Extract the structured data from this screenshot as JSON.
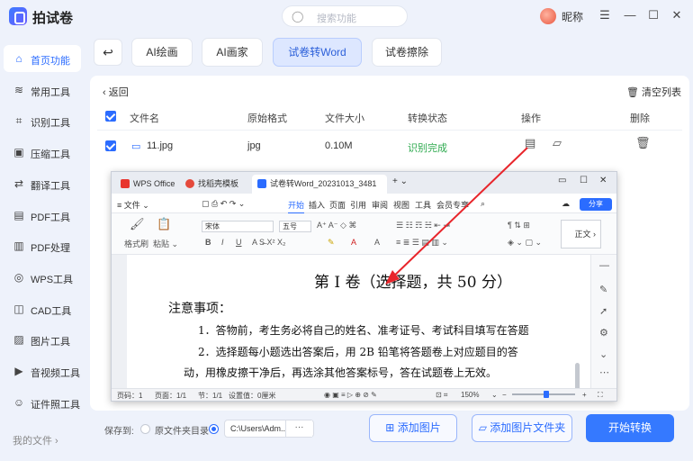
{
  "app": {
    "name": "拍试卷",
    "search_placeholder": "搜索功能",
    "nickname": "昵称"
  },
  "window_controls": [
    "☰",
    "—",
    "☐",
    "✕"
  ],
  "sidebar": {
    "items": [
      {
        "label": "首页功能",
        "icon": "home-icon",
        "glyph": "⌂"
      },
      {
        "label": "常用工具",
        "icon": "layers-icon",
        "glyph": "≋"
      },
      {
        "label": "识别工具",
        "icon": "scan-icon",
        "glyph": "⌗"
      },
      {
        "label": "压缩工具",
        "icon": "compress-icon",
        "glyph": "▣"
      },
      {
        "label": "翻译工具",
        "icon": "translate-icon",
        "glyph": "⇄"
      },
      {
        "label": "PDF工具",
        "icon": "pdf-icon",
        "glyph": "▤"
      },
      {
        "label": "PDF处理",
        "icon": "pdf-process-icon",
        "glyph": "▥"
      },
      {
        "label": "WPS工具",
        "icon": "wps-icon",
        "glyph": "◎"
      },
      {
        "label": "CAD工具",
        "icon": "cad-icon",
        "glyph": "◫"
      },
      {
        "label": "图片工具",
        "icon": "image-icon",
        "glyph": "▨"
      },
      {
        "label": "音视频工具",
        "icon": "video-icon",
        "glyph": "▶"
      },
      {
        "label": "证件照工具",
        "icon": "id-photo-icon",
        "glyph": "☺"
      }
    ],
    "bottom": "我的文件 ›"
  },
  "tabs": [
    "AI绘画",
    "AI画家",
    "试卷转Word",
    "试卷擦除"
  ],
  "list": {
    "back": "‹ 返回",
    "clear": "清空列表",
    "headers": {
      "name": "文件名",
      "format": "原始格式",
      "size": "文件大小",
      "status": "转换状态",
      "ops": "操作",
      "delete": "删除"
    },
    "rows": [
      {
        "name": "11.jpg",
        "format": "jpg",
        "size": "0.10M",
        "status": "识别完成"
      }
    ]
  },
  "bottom": {
    "save_to": "保存到:",
    "option_source": "原文件夹目录",
    "path": "C:\\Users\\Adm...",
    "path_more": "···",
    "add_image": "添加图片",
    "add_folder": "添加图片文件夹",
    "start": "开始转换"
  },
  "wps": {
    "tabs": [
      "WPS Office",
      "找稻壳模板",
      "试卷转Word_20231013_3481"
    ],
    "tab_plus": "+ ⌄",
    "menu": [
      "≡ 文件 ⌄",
      "开始",
      "插入",
      "页面",
      "引用",
      "审阅",
      "视图",
      "工具",
      "会员专享"
    ],
    "share": "分享",
    "ribbon": {
      "format_painter": "格式刷",
      "paste": "粘贴 ⌄",
      "font": "宋体",
      "size": "五号",
      "style": "正文"
    },
    "doc": {
      "title": "第 I 卷（选择题，共 50 分）",
      "notice": "注意事项：",
      "line1": "1．答物前，考生务必将自己的姓名、准考证号、考试科目填写在答题",
      "line2": "2．选择题每小题选出答案后，用 2B 铅笔将答题卷上对应题目的答",
      "line3": "动，用橡皮擦干净后，再选涂其他答案标号，答在试题卷上无效。"
    },
    "status": {
      "page": "页码：1",
      "pages": "页面：1/1",
      "section": "节：1/1",
      "setting": "设置值：0厘米",
      "zoom": "150%"
    }
  },
  "colors": {
    "accent": "#2b6cff",
    "success": "#2eaa4f",
    "annotation": "#e8252b"
  }
}
